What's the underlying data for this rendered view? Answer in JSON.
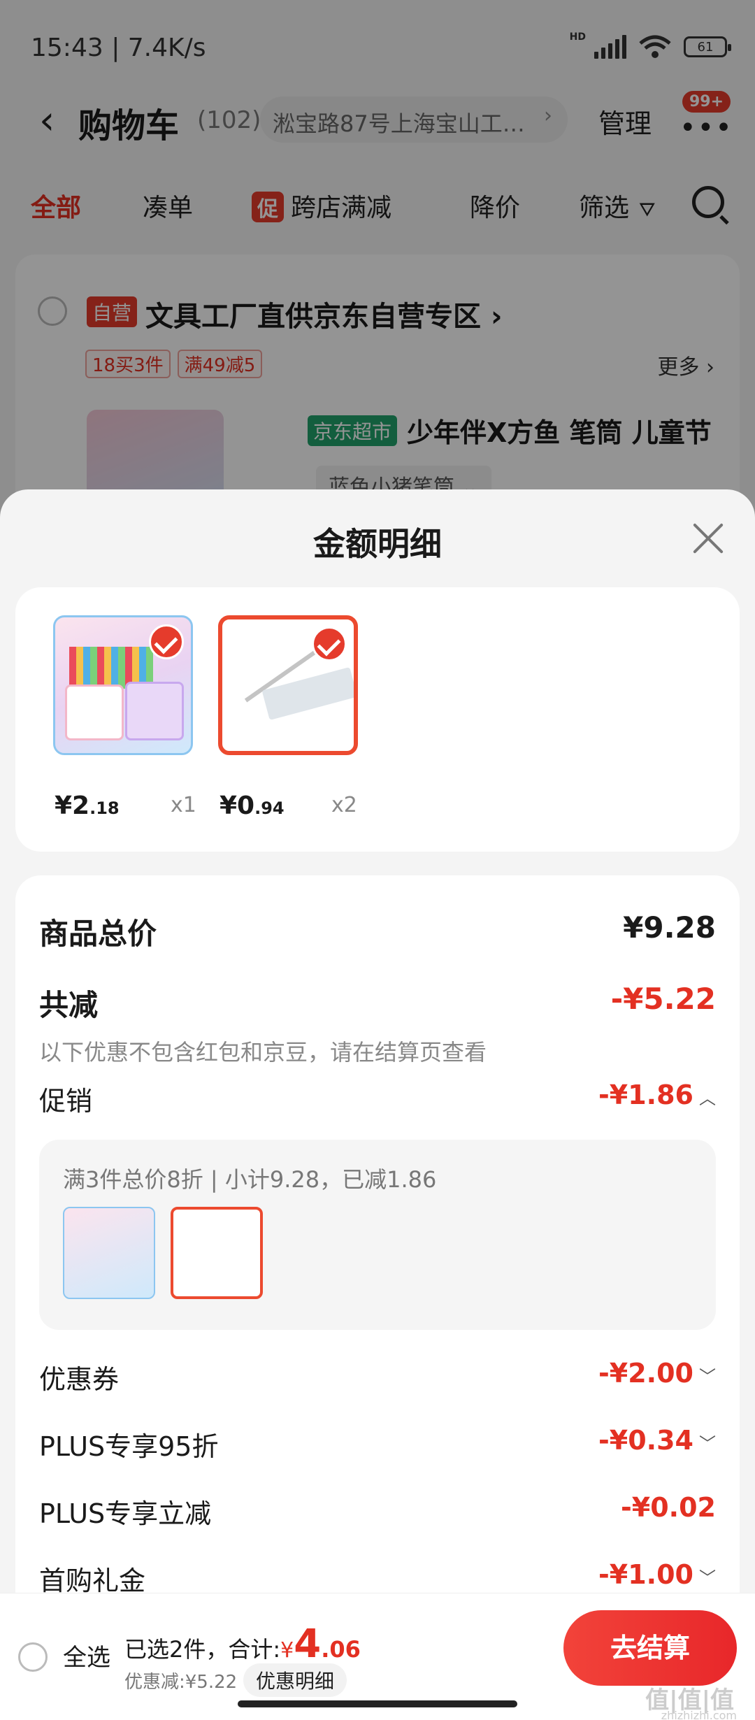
{
  "status": {
    "time": "15:43 | 7.4K/s",
    "network": "HD",
    "battery": "61"
  },
  "header": {
    "back_icon": "chevron-left",
    "title": "购物车",
    "count": "(102)",
    "address": "淞宝路87号上海宝山工…",
    "address_chevron": "›",
    "manage": "管理",
    "more_badge": "99+",
    "more_dots": "•••"
  },
  "tabs": [
    {
      "label": "全部",
      "active": true
    },
    {
      "label": "凑单"
    },
    {
      "tag": "促",
      "label": "跨店满减"
    },
    {
      "label": "降价"
    },
    {
      "label": "筛选"
    }
  ],
  "store": {
    "self_tag": "自营",
    "name": "文具工厂直供京东自营专区",
    "chevron": "›",
    "chips": [
      "18买3件",
      "满49减5"
    ],
    "more": "更多 ›",
    "jd_tag": "京东超市",
    "product_title": "少年伴X方鱼 笔筒 儿童节",
    "spec": "蓝色小猪笔筒 ⌄"
  },
  "sheet": {
    "title": "金额明细",
    "items": [
      {
        "price_int": "¥2",
        "price_dec": ".18",
        "qty": "x1"
      },
      {
        "price_int": "¥0",
        "price_dec": ".94",
        "qty": "x2"
      }
    ],
    "total_label": "商品总价",
    "total_value": "¥9.28",
    "reduce_label": "共减",
    "reduce_value": "-¥5.22",
    "reduce_note": "以下优惠不包含红包和京豆，请在结算页查看",
    "promo_label": "促销",
    "promo_value": "-¥1.86",
    "promo_detail": "满3件总价8折 | 小计9.28，已减1.86",
    "coupon_label": "优惠券",
    "coupon_value": "-¥2.00",
    "plus95_label": "PLUS专享95折",
    "plus95_value": "-¥0.34",
    "plusreduce_label": "PLUS专享立减",
    "plusreduce_value": "-¥0.02",
    "firstbuy_label": "首购礼金",
    "firstbuy_value": "-¥1.00"
  },
  "bottom": {
    "select_all": "全选",
    "selected_text": "已选2件，合计:",
    "currency": "¥",
    "total_int": "4",
    "total_dec": ".06",
    "saved": "优惠减:¥5.22",
    "detail_button": "优惠明细",
    "checkout": "去结算"
  },
  "watermark": {
    "main": "值|值|值",
    "sub": "zhizhizhi.com"
  },
  "colors": {
    "accent": "#e33022",
    "jd_green": "#21a36b"
  }
}
